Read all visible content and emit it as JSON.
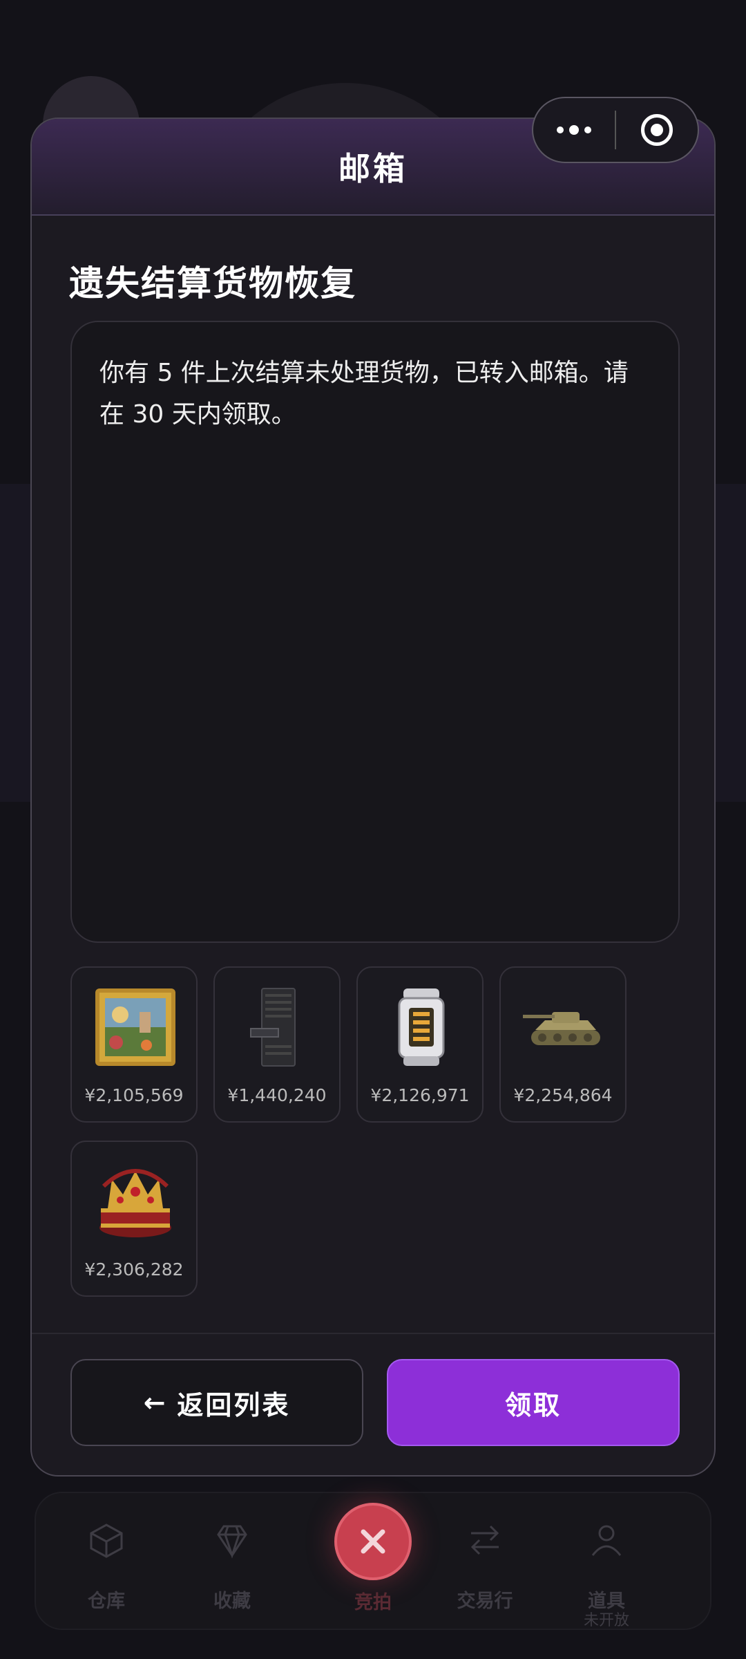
{
  "capsule": {
    "more_icon": "more-dots-icon",
    "close_icon": "target-circle-icon"
  },
  "modal": {
    "title": "邮箱",
    "subject": "遗失结算货物恢复",
    "message": "你有 5 件上次结算未处理货物，已转入邮箱。请在 30 天内领取。",
    "items": [
      {
        "name": "painting",
        "icon": "framed-painting-icon",
        "price": "¥2,105,569"
      },
      {
        "name": "server-rack",
        "icon": "server-rack-icon",
        "price": "¥1,440,240"
      },
      {
        "name": "lantern-device",
        "icon": "energy-core-icon",
        "price": "¥2,126,971"
      },
      {
        "name": "tank",
        "icon": "tank-icon",
        "price": "¥2,254,864"
      },
      {
        "name": "crown-box",
        "icon": "crown-box-icon",
        "price": "¥2,306,282"
      }
    ],
    "back_button": "返回列表",
    "claim_button": "领取"
  },
  "tabbar": {
    "tabs": [
      {
        "label": "仓库",
        "icon": "box-icon"
      },
      {
        "label": "收藏",
        "icon": "diamond-icon"
      },
      {
        "label": "竞拍",
        "icon": "close-icon"
      },
      {
        "label": "交易行",
        "icon": "swap-arrows-icon"
      },
      {
        "label": "道具",
        "sub": "未开放",
        "icon": "person-icon"
      }
    ]
  },
  "colors": {
    "accent": "#8d2fd8",
    "fab": "#c8404f",
    "background": "#131218"
  }
}
